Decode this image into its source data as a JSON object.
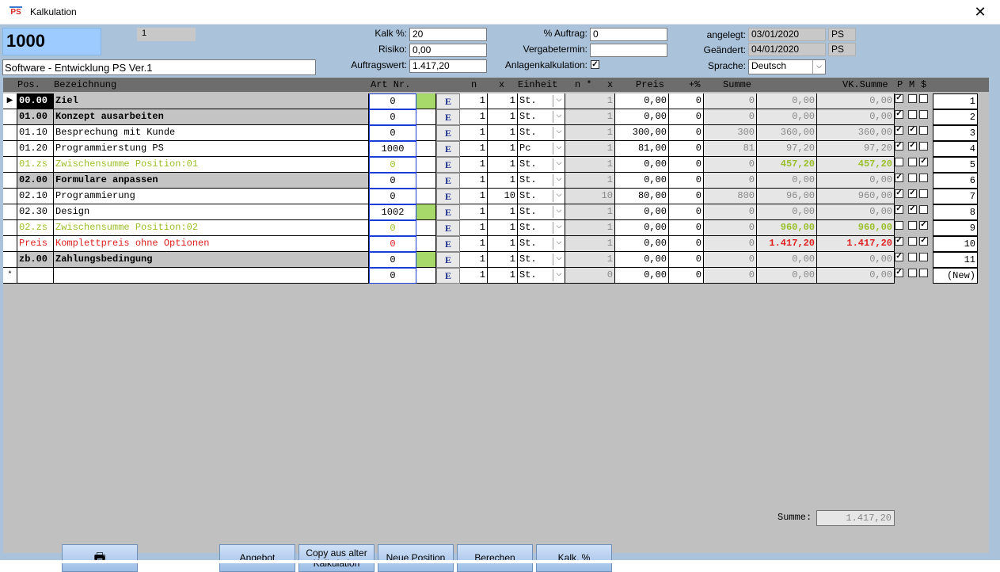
{
  "window": {
    "title": "Kalkulation",
    "app_icon": "PS",
    "close": "✕"
  },
  "header": {
    "kalk_number": "1000",
    "small_number": "1",
    "project_title": "Software - Entwicklung PS Ver.1",
    "kalk_pct_label": "Kalk %:",
    "kalk_pct": "20",
    "risiko_label": "Risiko:",
    "risiko": "0,00",
    "auftragswert_label": "Auftragswert:",
    "auftragswert": "1.417,20",
    "pct_auftrag_label": "% Auftrag:",
    "pct_auftrag": "0",
    "vergabetermin_label": "Vergabetermin:",
    "vergabetermin": "",
    "anlagen_label": "Anlagenkalkulation:",
    "anlagen_checked": true,
    "angelegt_label": "angelegt:",
    "angelegt": "03/01/2020",
    "angelegt_user": "PS",
    "geaendert_label": "Geändert:",
    "geaendert": "04/01/2020",
    "geaendert_user": "PS",
    "sprache_label": "Sprache:",
    "sprache": "Deutsch"
  },
  "grid": {
    "columns": [
      "Pos.",
      "Bezeichnung",
      "Art Nr.",
      "n",
      "x",
      "Einheit",
      "n *",
      "x",
      "Preis",
      "+%",
      "Summe",
      "VK.Summe",
      "P",
      "M",
      "$"
    ],
    "rows": [
      {
        "pos": "00.00",
        "bez": "Ziel",
        "art": "0",
        "color": "#a6d86a",
        "n": "1",
        "x": "1",
        "unit": "St.",
        "nx": "1",
        "preis": "0,00",
        "plus": "0",
        "summe": "0",
        "vk1": "0,00",
        "vk2": "0,00",
        "p": true,
        "m": false,
        "s": false,
        "rn": "1",
        "style": "t-bold",
        "selected": true
      },
      {
        "pos": "01.00",
        "bez": "Konzept ausarbeiten",
        "art": "0",
        "color": "",
        "n": "1",
        "x": "1",
        "unit": "St.",
        "nx": "1",
        "preis": "0,00",
        "plus": "0",
        "summe": "0",
        "vk1": "0,00",
        "vk2": "0,00",
        "p": true,
        "m": false,
        "s": false,
        "rn": "2",
        "style": "t-bold"
      },
      {
        "pos": "01.10",
        "bez": "Besprechung mit Kunde",
        "art": "0",
        "color": "",
        "n": "1",
        "x": "1",
        "unit": "St.",
        "nx": "1",
        "preis": "300,00",
        "plus": "0",
        "summe": "300",
        "vk1": "360,00",
        "vk2": "360,00",
        "p": true,
        "m": true,
        "s": false,
        "rn": "3",
        "style": "t-normal"
      },
      {
        "pos": "01.20",
        "bez": "Programmierstung PS",
        "art": "1000",
        "color": "",
        "n": "1",
        "x": "1",
        "unit": "Pc",
        "nx": "1",
        "preis": "81,00",
        "plus": "0",
        "summe": "81",
        "vk1": "97,20",
        "vk2": "97,20",
        "p": true,
        "m": true,
        "s": false,
        "rn": "4",
        "style": "t-normal"
      },
      {
        "pos": "01.zs",
        "bez": "Zwischensumme Position:01",
        "art": "0",
        "color": "",
        "n": "1",
        "x": "1",
        "unit": "St.",
        "nx": "1",
        "preis": "0,00",
        "plus": "0",
        "summe": "0",
        "vk1": "457,20",
        "vk2": "457,20",
        "p": false,
        "m": false,
        "s": true,
        "rn": "5",
        "style": "t-sub"
      },
      {
        "pos": "02.00",
        "bez": "Formulare anpassen",
        "art": "0",
        "color": "",
        "n": "1",
        "x": "1",
        "unit": "St.",
        "nx": "1",
        "preis": "0,00",
        "plus": "0",
        "summe": "0",
        "vk1": "0,00",
        "vk2": "0,00",
        "p": true,
        "m": false,
        "s": false,
        "rn": "6",
        "style": "t-bold"
      },
      {
        "pos": "02.10",
        "bez": "Programmierung",
        "art": "0",
        "color": "",
        "n": "1",
        "x": "10",
        "unit": "St.",
        "nx": "10",
        "preis": "80,00",
        "plus": "0",
        "summe": "800",
        "vk1": "96,00",
        "vk2": "960,00",
        "p": true,
        "m": true,
        "s": false,
        "rn": "7",
        "style": "t-normal"
      },
      {
        "pos": "02.30",
        "bez": "Design",
        "art": "1002",
        "color": "#a6d86a",
        "n": "1",
        "x": "1",
        "unit": "St.",
        "nx": "1",
        "preis": "0,00",
        "plus": "0",
        "summe": "0",
        "vk1": "0,00",
        "vk2": "0,00",
        "p": true,
        "m": true,
        "s": false,
        "rn": "8",
        "style": "t-normal"
      },
      {
        "pos": "02.zs",
        "bez": "Zwischensumme Position:02",
        "art": "0",
        "color": "",
        "n": "1",
        "x": "1",
        "unit": "St.",
        "nx": "1",
        "preis": "0,00",
        "plus": "0",
        "summe": "0",
        "vk1": "960,00",
        "vk2": "960,00",
        "p": false,
        "m": false,
        "s": true,
        "rn": "9",
        "style": "t-sub"
      },
      {
        "pos": "Preis",
        "bez": "Komplettpreis ohne Optionen",
        "art": "0",
        "color": "",
        "n": "1",
        "x": "1",
        "unit": "St.",
        "nx": "1",
        "preis": "0,00",
        "plus": "0",
        "summe": "0",
        "vk1": "1.417,20",
        "vk2": "1.417,20",
        "p": true,
        "m": false,
        "s": true,
        "rn": "10",
        "style": "t-red"
      },
      {
        "pos": "zb.00",
        "bez": "Zahlungsbedingung",
        "art": "0",
        "color": "#a6d86a",
        "n": "1",
        "x": "1",
        "unit": "St.",
        "nx": "1",
        "preis": "0,00",
        "plus": "0",
        "summe": "0",
        "vk1": "0,00",
        "vk2": "0,00",
        "p": true,
        "m": false,
        "s": false,
        "rn": "11",
        "style": "t-bold"
      },
      {
        "pos": "",
        "bez": "",
        "art": "0",
        "color": "",
        "n": "1",
        "x": "1",
        "unit": "St.",
        "nx": "0",
        "preis": "0,00",
        "plus": "0",
        "summe": "0",
        "vk1": "0,00",
        "vk2": "0,00",
        "p": true,
        "m": false,
        "s": false,
        "rn": "(New)",
        "style": "t-normal",
        "new": true
      }
    ],
    "edit_button": "E",
    "new_row_marker": "*",
    "row_pointer": "▶"
  },
  "summe": {
    "label": "Summe:",
    "value": "1.417,20"
  },
  "buttons": {
    "print_icon": "🖶",
    "angebot": "Angebot",
    "copy_alter": "Copy aus alter Kalkulation",
    "neue_position": "Neue Position",
    "berechen": "Berechen",
    "kalk_pct": "Kalk. %"
  }
}
